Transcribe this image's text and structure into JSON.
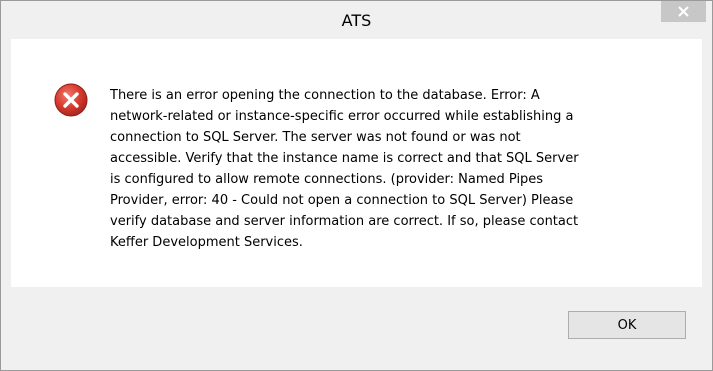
{
  "window": {
    "title": "ATS",
    "close_icon": "close-icon"
  },
  "message": {
    "icon": "error-icon",
    "text": "There is an error opening the connection to the database. Error: A\nnetwork-related or instance-specific error occurred while establishing a\nconnection to SQL Server. The server was not found or was not\naccessible. Verify that the instance name is correct and that SQL Server\nis configured to allow remote connections. (provider: Named Pipes\nProvider, error: 40 - Could not open a connection to SQL Server)  Please\nverify database and server information are correct.  If so, please contact\nKeffer Development Services."
  },
  "buttons": {
    "ok_label": "OK"
  },
  "colors": {
    "error_red": "#d83b2f",
    "close_button_bg": "#c7c7c7",
    "dialog_bg": "#f0f0f0"
  }
}
